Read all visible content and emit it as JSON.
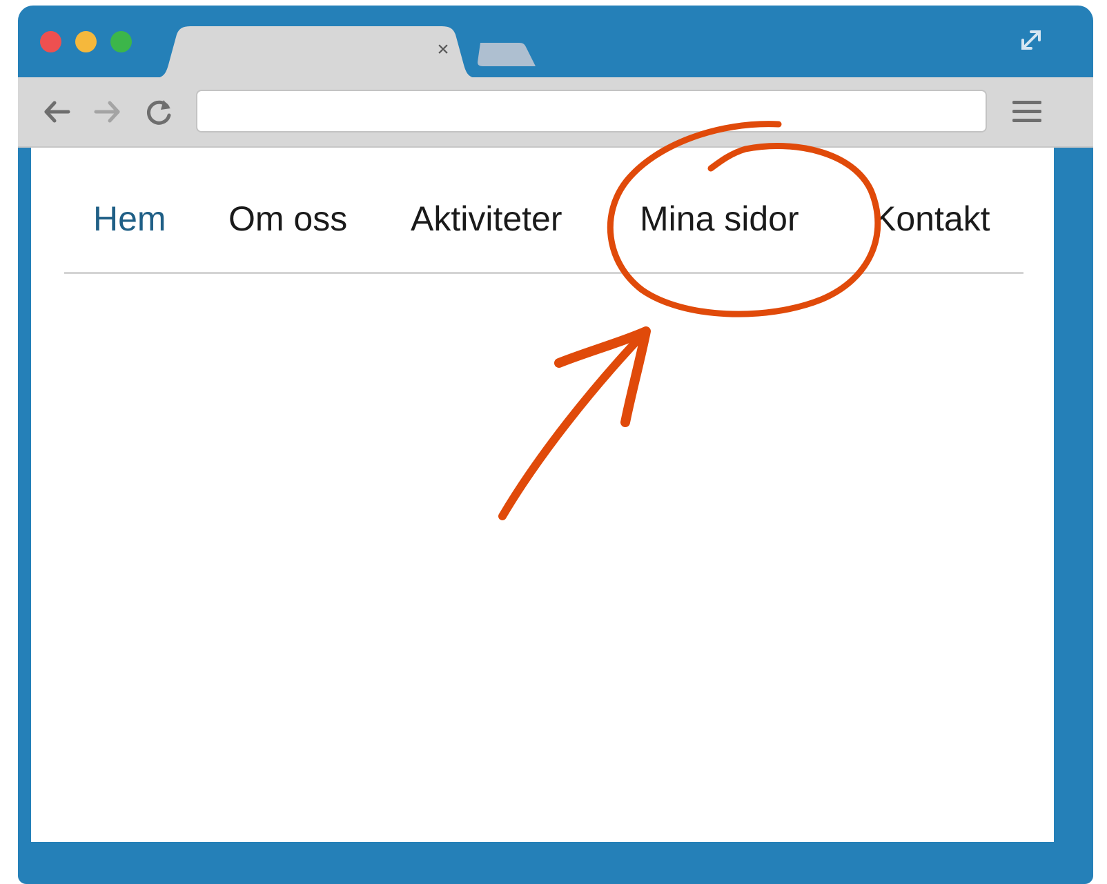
{
  "browser": {
    "tab": {
      "title": "",
      "close_glyph": "×",
      "close_icon": "close-icon"
    },
    "new_tab_icon": "new-tab-icon",
    "fullscreen_icon": "fullscreen-arrows-icon",
    "toolbar": {
      "back_icon": "arrow-left-icon",
      "forward_icon": "arrow-right-icon",
      "reload_icon": "reload-icon",
      "address": {
        "value": "",
        "placeholder": ""
      },
      "menu_icon": "hamburger-menu-icon"
    },
    "colors": {
      "frame": "#2580b8",
      "toolbar": "#d7d7d7",
      "light_red": "#ee5050",
      "light_yellow": "#f5b83c",
      "light_green": "#3cb64a"
    }
  },
  "site": {
    "nav": {
      "items": [
        {
          "label": "Hem",
          "active": true
        },
        {
          "label": "Om oss",
          "active": false
        },
        {
          "label": "Aktiviteter",
          "active": false
        },
        {
          "label": "Mina sidor",
          "active": false,
          "highlighted": true
        },
        {
          "label": "Kontakt",
          "active": false
        }
      ]
    }
  },
  "annotation": {
    "target": "Mina sidor",
    "color": "#e04a0a",
    "shapes": [
      "circle",
      "arrow"
    ]
  }
}
